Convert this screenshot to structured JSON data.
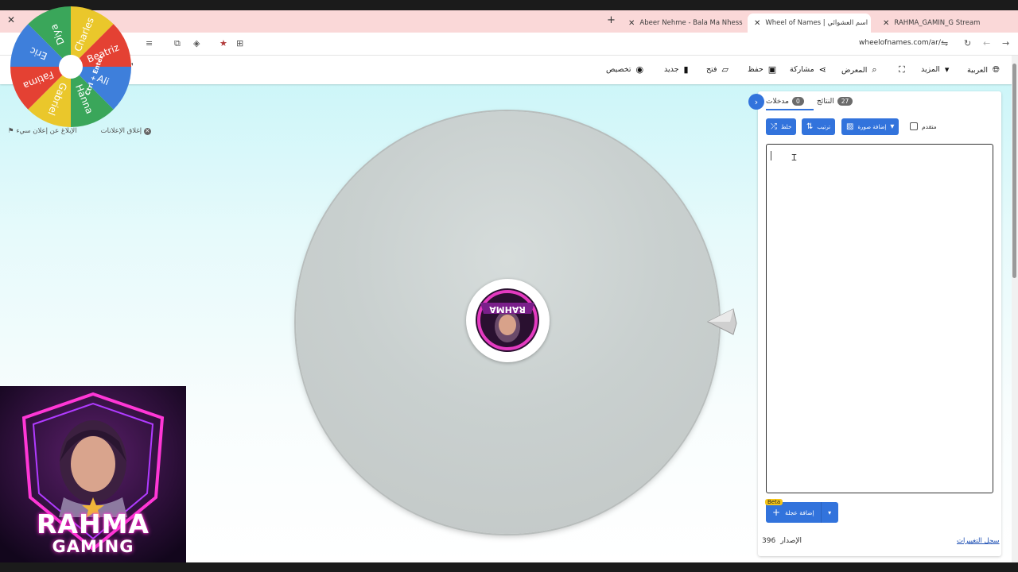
{
  "browser": {
    "tabs": [
      {
        "title": "Abeer Nehme - Bala Ma Nhess",
        "favicon": "youtube-icon"
      },
      {
        "title": "Wheel of Names | اسم العشوائي",
        "favicon": "wheel-icon",
        "active": true
      },
      {
        "title": "RAHMA_GAMIN_G Stream - Wi",
        "favicon": "kick-icon"
      }
    ],
    "url": "wheelofnames.com/ar/"
  },
  "nav": {
    "language": "العربية",
    "more": "المزيد",
    "gallery": "المعرض",
    "share": "مشاركة",
    "save": "حفظ",
    "open": "فتح",
    "new": "جديد",
    "customize": "تخصيص"
  },
  "panel": {
    "entries_tab": "مدخلات",
    "entries_count": "0",
    "results_tab": "النتائج",
    "results_count": "27",
    "shuffle": "خلط",
    "sort": "ترتيب",
    "add_image": "إضافة صورة",
    "advanced": "متقدم",
    "entries_text": "",
    "add_wheel": "إضافة عجلة",
    "beta": "Beta",
    "version_label": "الإصدار",
    "version": "396",
    "changelog": "سجل التغييرات"
  },
  "overlay": {
    "mini_wheel_names": [
      "Charles",
      "Beatriz",
      "Ali",
      "Hanna",
      "Gabriel",
      "Fatima",
      "Eric",
      "Diya"
    ],
    "hint_center": "Ctrl + Enter",
    "close_ads": "إغلاق الإعلانات",
    "report_ad": "الإبلاغ عن إعلان سيء"
  },
  "webcam": {
    "title_line1": "RAHMA",
    "title_line2": "GAMING"
  },
  "colors": {
    "accent": "#3273dc",
    "tabbar": "#fad8d8",
    "wheel_fill": "#c9d0cf"
  }
}
